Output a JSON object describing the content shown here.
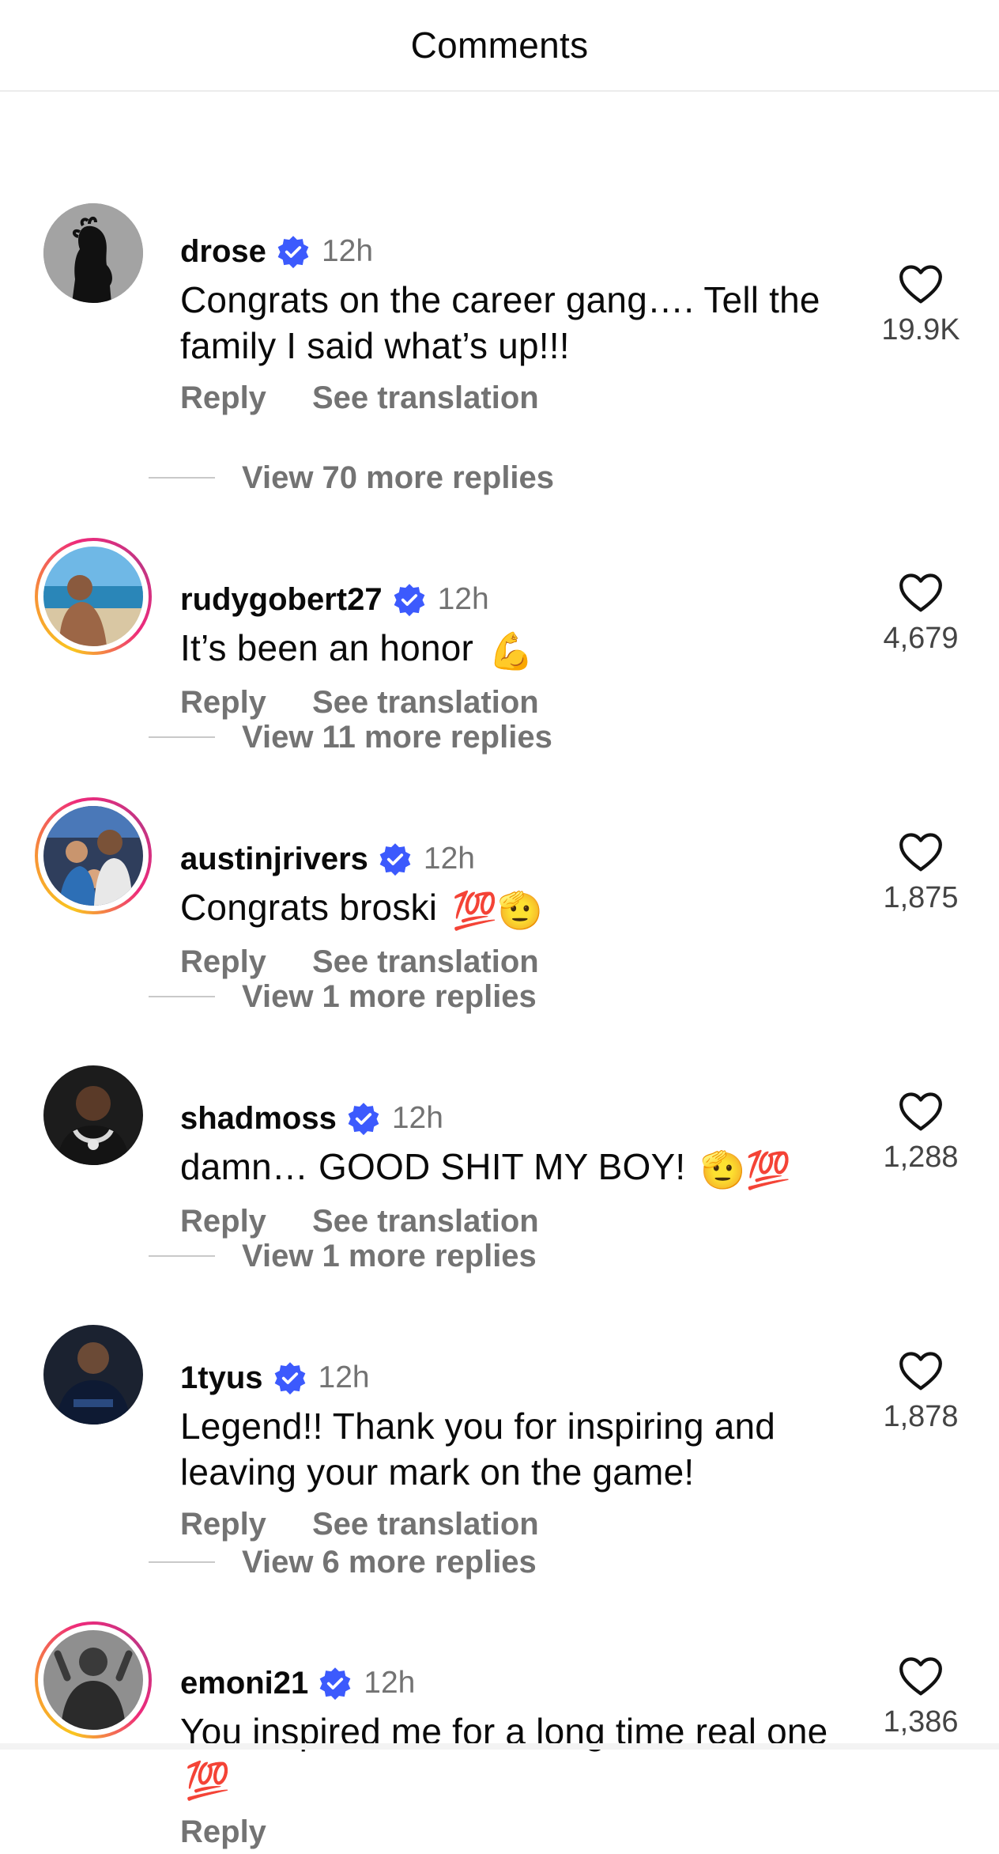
{
  "header": {
    "title": "Comments"
  },
  "comments": [
    {
      "username": "drose",
      "time": "12h",
      "text": "Congrats on the career gang…. Tell the family I said what’s up!!!",
      "reply": "Reply",
      "translate": "See translation",
      "likes": "19.9K",
      "view_replies": "View 70 more replies",
      "story_ring": false
    },
    {
      "username": "rudygobert27",
      "time": "12h",
      "text": "It’s been an honor",
      "emoji": "💪",
      "reply": "Reply",
      "translate": "See translation",
      "likes": "4,679",
      "view_replies": "View 11 more replies",
      "story_ring": true
    },
    {
      "username": "austinjrivers",
      "time": "12h",
      "text": "Congrats broski",
      "emoji": "💯🫡",
      "reply": "Reply",
      "translate": "See translation",
      "likes": "1,875",
      "view_replies": "View 1 more replies",
      "story_ring": true
    },
    {
      "username": "shadmoss",
      "time": "12h",
      "text": "damn… GOOD SHIT MY BOY!",
      "emoji": "🫡💯",
      "reply": "Reply",
      "translate": "See translation",
      "likes": "1,288",
      "view_replies": "View 1 more replies",
      "story_ring": false
    },
    {
      "username": "1tyus",
      "time": "12h",
      "text": "Legend!! Thank you for inspiring and leaving your mark on the game!",
      "reply": "Reply",
      "translate": "See translation",
      "likes": "1,878",
      "view_replies": "View 6 more replies",
      "story_ring": false
    },
    {
      "username": "emoni21",
      "time": "12h",
      "text": "You inspired me for a long time real one",
      "emoji": "💯",
      "reply": "Reply",
      "likes": "1,386",
      "story_ring": true
    }
  ],
  "colors": {
    "verified": "#3c5afd",
    "secondary_text": "#737373",
    "divider": "#ececec"
  },
  "icons": {
    "like": "heart-outline-icon",
    "verified": "verified-badge-icon"
  }
}
